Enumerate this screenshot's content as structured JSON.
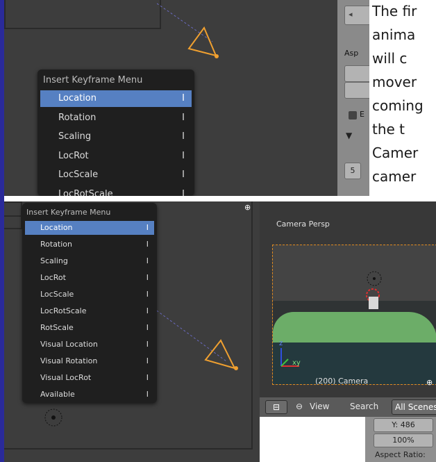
{
  "top_panel": {
    "menu": {
      "title": "Insert Keyframe Menu",
      "items": [
        {
          "label": "Location",
          "shortcut": "I"
        },
        {
          "label": "Rotation",
          "shortcut": "I"
        },
        {
          "label": "Scaling",
          "shortcut": "I"
        },
        {
          "label": "LocRot",
          "shortcut": "I"
        },
        {
          "label": "LocScale",
          "shortcut": "I"
        },
        {
          "label": "LocRotScale",
          "shortcut": "I"
        }
      ]
    },
    "sidebar": {
      "aspect_label": "Asp",
      "number": "5",
      "checkbox_letter": "E"
    },
    "overlay_text": [
      "The fir",
      "anima",
      "will   c",
      "mover",
      "coming",
      "the   t",
      "Camer",
      "camer"
    ]
  },
  "bottom_panel": {
    "menu": {
      "title": "Insert Keyframe Menu",
      "items": [
        {
          "label": "Location",
          "shortcut": "I"
        },
        {
          "label": "Rotation",
          "shortcut": "I"
        },
        {
          "label": "Scaling",
          "shortcut": "I"
        },
        {
          "label": "LocRot",
          "shortcut": "I"
        },
        {
          "label": "LocScale",
          "shortcut": "I"
        },
        {
          "label": "LocRotScale",
          "shortcut": "I"
        },
        {
          "label": "RotScale",
          "shortcut": "I"
        },
        {
          "label": "Visual Location",
          "shortcut": "I"
        },
        {
          "label": "Visual Rotation",
          "shortcut": "I"
        },
        {
          "label": "Visual LocRot",
          "shortcut": "I"
        },
        {
          "label": "Available",
          "shortcut": "I"
        }
      ]
    },
    "camera_view": {
      "header": "Camera Persp",
      "footer": "(200) Camera",
      "axis_z": "z",
      "axis_xy": "xy"
    },
    "toolbar": {
      "view_label": "View",
      "search_label": "Search",
      "scenes_label": "All Scenes"
    },
    "properties": {
      "y_field": "Y: 486",
      "percent_field": "100%",
      "aspect_label": "Aspect Ratio:"
    }
  },
  "colors": {
    "viewport_bg": "#3d3d3d",
    "menu_bg": "#1f1f1f",
    "menu_selected": "#5680c2",
    "camera_orange": "#f0a030",
    "left_strip": "#2a2a9a"
  }
}
